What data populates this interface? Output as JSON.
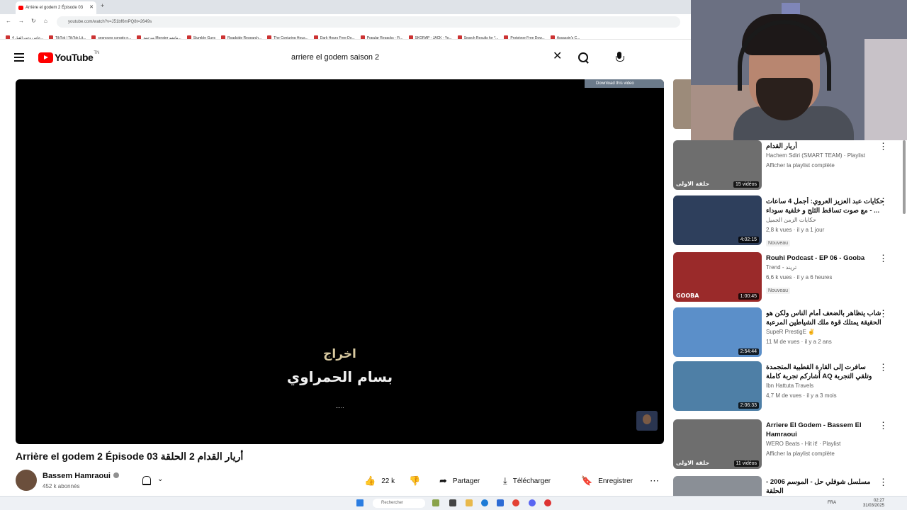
{
  "browser": {
    "tab_title": "Arrière el godem 2 Épisode 03",
    "url": "youtube.com/watch?v=J51bf6mPQ8t=2649s",
    "bookmarks": [
      "خاتم روجت الفيل 4...",
      "TikTok | TikTok Lit...",
      "sesnoces congés n...",
      "مترجمة Monster ماتشو...",
      "Stumble Guys",
      "Roadside Research...",
      "The Conjuring Hous...",
      "Dark Hours Free Do...",
      "Popular Repacks - Fi...",
      "SKORAP - JACK - Yo...",
      "Search Results for *...",
      "Prototype Free Dow...",
      "Assassin's C..."
    ]
  },
  "header": {
    "logo_text": "YouTube",
    "country_code": "TN",
    "search_value": "arriere el godem saison 2"
  },
  "player": {
    "download_label": "Download this video",
    "credit_role": "اخراج",
    "credit_name": "بسام الحمراوي",
    "credit_more": "....."
  },
  "video": {
    "title": "Arrière el godem 2 Épisode 03 أريار القدام 2 الحلقة",
    "channel_name": "Bassem Hamraoui",
    "subscribers": "452 k abonnés",
    "likes": "22 k",
    "share_label": "Partager",
    "download_label": "Télécharger",
    "save_label": "Enregistrer"
  },
  "recommendations": [
    {
      "title": "أريار القدام",
      "channel": "Hachem Sdiri (SMART TEAM) · Playlist",
      "meta": "Afficher la playlist complète",
      "badge": "",
      "overlay": "15 vidéos",
      "thumb_text": "حلقة الاولى",
      "color": "#6e6e6e"
    },
    {
      "title": "حكايات عبد العزيز العروي: أجمل 4 ساعات مع صوت تساقط الثلج و خلفية سوداء - ...",
      "channel": "حكايات الزمن الجميل",
      "meta": "2,8 k vues · il y a 1 jour",
      "badge": "Nouveau",
      "overlay": "4:02:15",
      "thumb_text": "",
      "color": "#2e3f5c"
    },
    {
      "title": "Rouhi Podcast - EP 06 - Gooba",
      "channel": "Trend - تريند",
      "meta": "6,6 k vues · il y a 6 heures",
      "badge": "Nouveau",
      "overlay": "1:00:45",
      "thumb_text": "GOOBA",
      "color": "#9a2a2a"
    },
    {
      "title": "شاب يتظاهر بالضعف أمام الناس ولكن هو الحقيقة يمتلك قوة ملك الشياطين المرعبة || ...",
      "channel": "SupeR PrestigE ✌",
      "meta": "11 M de vues · il y a 2 ans",
      "badge": "",
      "overlay": "2:54:44",
      "thumb_text": "",
      "color": "#5b8fc9"
    },
    {
      "title": "سافرت إلى القارة القطبية المتجمدة أشاركم تجربة كاملة AQ وتلقي التجربة كاملة",
      "channel": "Ibn Hattuta Travels",
      "meta": "4,7 M de vues · il y a 3 mois",
      "badge": "",
      "overlay": "2:06:33",
      "thumb_text": "",
      "color": "#4e7fa6"
    },
    {
      "title": "Arriere El Godem - Bassem El Hamraoui",
      "channel": "WERO Beats - Hit it! · Playlist",
      "meta": "Afficher la playlist complète",
      "badge": "",
      "overlay": "11 vidéos",
      "thumb_text": "حلقة الاولى",
      "color": "#6e6e6e"
    },
    {
      "title": "مسلسل شوفلي حل - الموسم 2006 - الحلقة",
      "channel": "",
      "meta": "",
      "badge": "",
      "overlay": "",
      "thumb_text": "",
      "color": "#8a8f96"
    }
  ],
  "taskbar": {
    "search_placeholder": "Rechercher",
    "language": "FRA",
    "time": "02:27",
    "date": "31/03/2025"
  }
}
